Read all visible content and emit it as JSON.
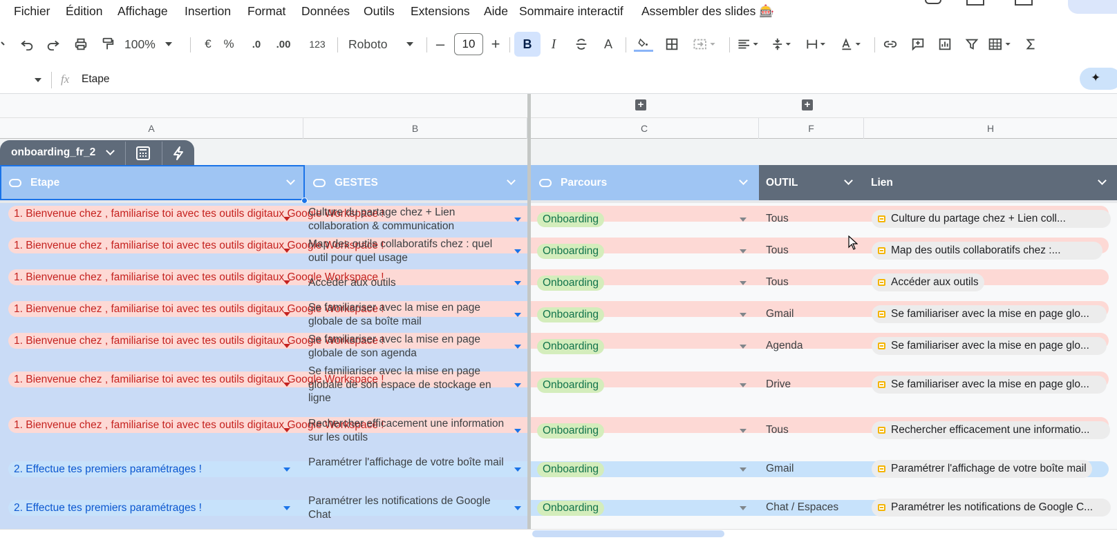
{
  "menu": [
    "Fichier",
    "Édition",
    "Affichage",
    "Insertion",
    "Format",
    "Données",
    "Outils",
    "Extensions",
    "Aide",
    "Sommaire interactif",
    "Assembler des slides 🎰"
  ],
  "toolbar": {
    "zoom": "100%",
    "currency": "€",
    "percent": "%",
    "decrease_decimal": ".0",
    "increase_decimal": ".00",
    "number_format": "123",
    "font": "Roboto",
    "font_size": "10",
    "bold": "B",
    "italic": "I",
    "text_color": "A"
  },
  "formula_bar": {
    "fx": "fx",
    "value": "Etape"
  },
  "columns": [
    "A",
    "B",
    "C",
    "F",
    "H"
  ],
  "table": {
    "name": "onboarding_fr_2"
  },
  "headers": {
    "etape": "Etape",
    "gestes": "GESTES",
    "parcours": "Parcours",
    "outil": "OUTIL",
    "lien": "Lien"
  },
  "rows": [
    {
      "etape": "1. Bienvenue chez          , familiarise toi avec tes outils digitaux Google Workspace !",
      "etape_style": "red",
      "gestes": "Culture du partage chez           + Lien collaboration & communication",
      "parcours": "Onboarding",
      "outil": "Tous",
      "lien": "Culture du partage chez           + Lien coll..."
    },
    {
      "etape": "1. Bienvenue chez          , familiarise toi avec tes outils digitaux Google Workspace !",
      "etape_style": "red",
      "gestes": "Map des outils collaboratifs chez              : quel outil pour quel usage",
      "parcours": "Onboarding",
      "outil": "Tous",
      "lien": "Map des outils collaboratifs chez           :..."
    },
    {
      "etape": "1. Bienvenue chez          , familiarise toi avec tes outils digitaux Google Workspace !",
      "etape_style": "red",
      "gestes": "Accéder aux outils",
      "parcours": "Onboarding",
      "outil": "Tous",
      "lien": "Accéder aux outils"
    },
    {
      "etape": "1. Bienvenue chez          , familiarise toi avec tes outils digitaux Google Workspace !",
      "etape_style": "red",
      "gestes": "Se familiariser avec la mise en page globale de sa boîte mail",
      "parcours": "Onboarding",
      "outil": "Gmail",
      "lien": "Se familiariser avec la mise en page glo..."
    },
    {
      "etape": "1. Bienvenue chez          , familiarise toi avec tes outils digitaux Google Workspace !",
      "etape_style": "red",
      "gestes": "Se familiariser avec la mise en page globale de son agenda",
      "parcours": "Onboarding",
      "outil": "Agenda",
      "lien": "Se familiariser avec la mise en page glo..."
    },
    {
      "etape": "1. Bienvenue chez          , familiarise toi avec tes outils digitaux Google Workspace !",
      "etape_style": "red",
      "gestes": "Se familiariser avec la mise en page globale de son espace de stockage en ligne",
      "parcours": "Onboarding",
      "outil": "Drive",
      "lien": "Se familiariser avec la mise en page glo..."
    },
    {
      "etape": "1. Bienvenue chez          , familiarise toi avec tes outils digitaux Google Workspace !",
      "etape_style": "red",
      "gestes": "Rechercher efficacement une information sur les outils",
      "parcours": "Onboarding",
      "outil": "Tous",
      "lien": "Rechercher efficacement une informatio..."
    },
    {
      "etape": "2. Effectue tes premiers paramétrages !",
      "etape_style": "blue",
      "gestes": "Paramétrer l'affichage de votre boîte mail",
      "parcours": "Onboarding",
      "outil": "Gmail",
      "lien": "Paramétrer l'affichage de votre boîte mail"
    },
    {
      "etape": "2. Effectue tes premiers paramétrages !",
      "etape_style": "blue",
      "gestes": "Paramétrer les notifications de Google Chat",
      "parcours": "Onboarding",
      "outil": "Chat / Espaces",
      "lien": "Paramétrer les notifications de Google C..."
    }
  ],
  "colors": {
    "header_blue": "#9fc5f3",
    "header_grey": "#5f6b7a",
    "col_blue": "#c9dbf6",
    "red_chip": "#fdd9d5",
    "onboarding_pill": "#d4edbc"
  }
}
